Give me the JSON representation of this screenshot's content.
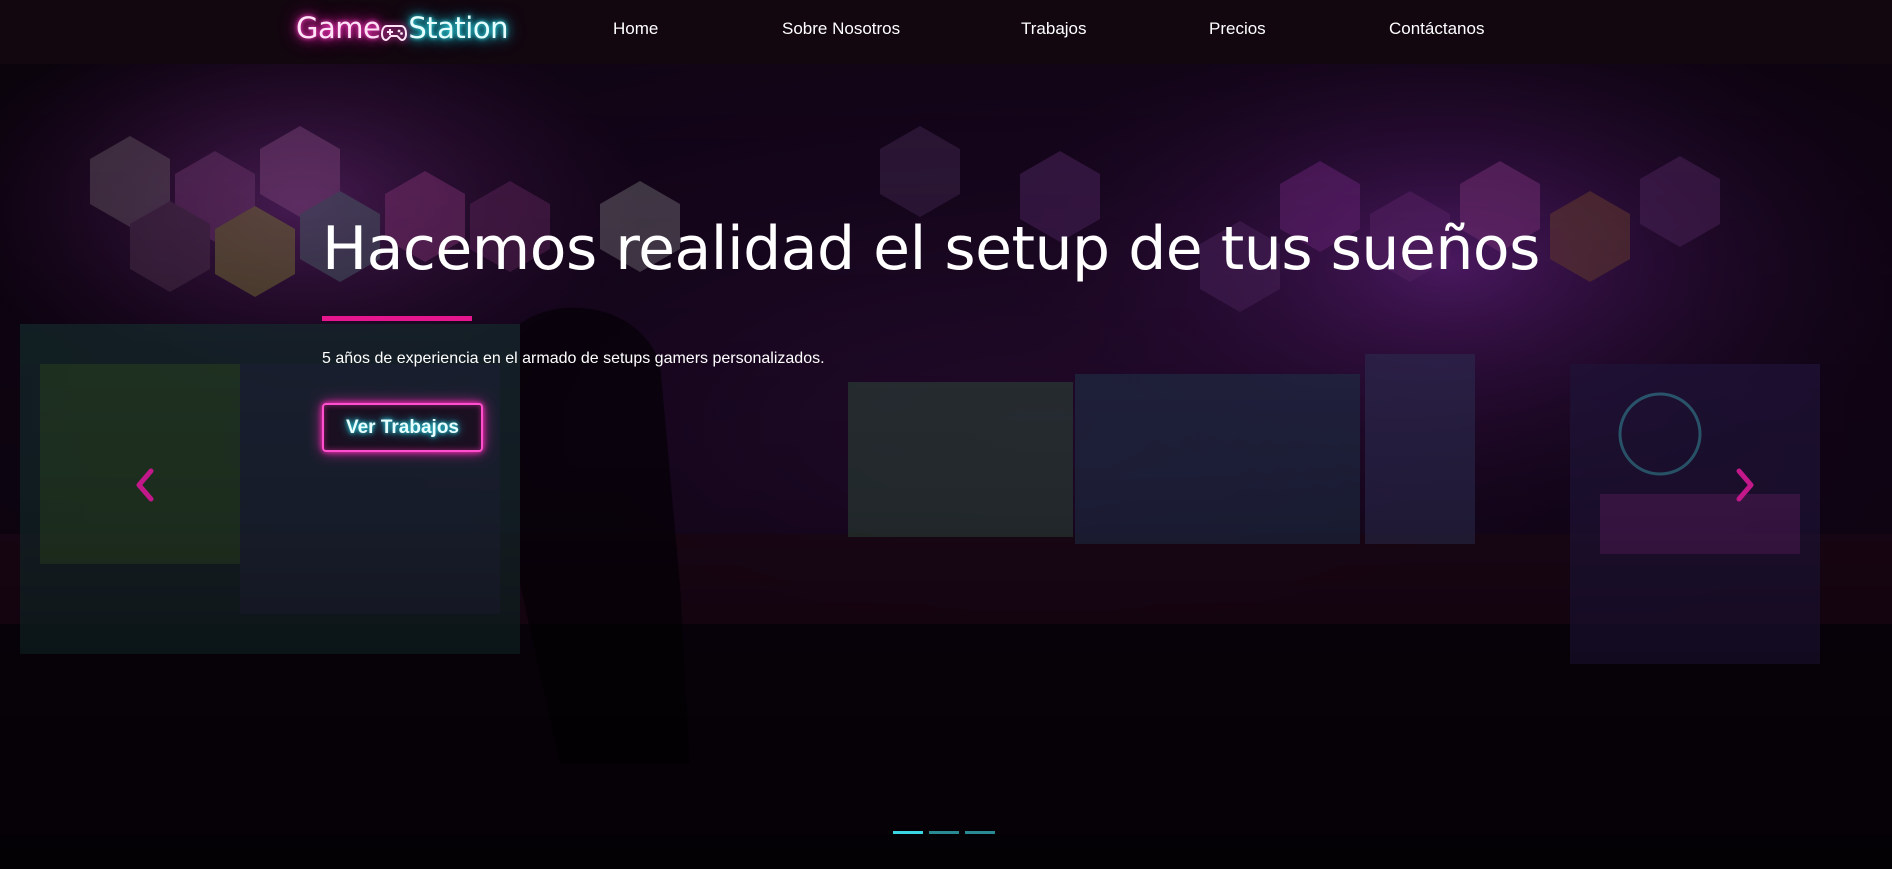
{
  "brand": {
    "part1": "Game",
    "part2": "Station",
    "icon": "gamepad-icon"
  },
  "nav": {
    "items": [
      {
        "label": "Home"
      },
      {
        "label": "Sobre Nosotros"
      },
      {
        "label": "Trabajos"
      },
      {
        "label": "Precios"
      },
      {
        "label": "Contáctanos"
      }
    ]
  },
  "hero": {
    "headline": "Hacemos realidad el setup de tus sueños",
    "subtitle": "5 años de experiencia en el armado de setups gamers personalizados.",
    "cta_label": "Ver Trabajos",
    "slides": {
      "count": 3,
      "active": 1
    },
    "prev_icon": "chevron-left-icon",
    "next_icon": "chevron-right-icon"
  },
  "colors": {
    "navbar_bg": "#12060f",
    "accent_pink": "#e6168f",
    "accent_cyan": "#3bd4e2",
    "text": "#ffffff"
  }
}
